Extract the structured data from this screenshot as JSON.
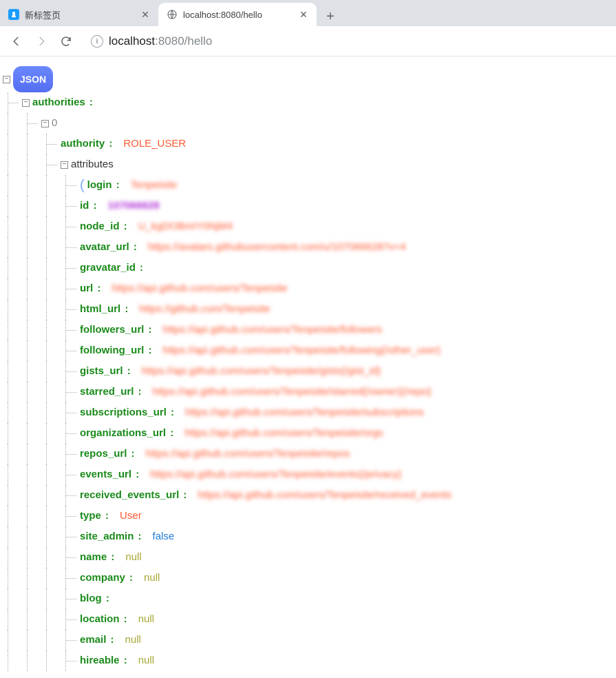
{
  "tabs": {
    "tab1": {
      "title": "新标签页"
    },
    "tab2": {
      "title": "localhost:8080/hello"
    }
  },
  "omnibox": {
    "host": "localhost",
    "rest": ":8080/hello"
  },
  "root_badge": "JSON",
  "tree": {
    "authorities_key": "authorities",
    "index0": "0",
    "authority_key": "authority",
    "authority_val": "ROLE_USER",
    "attributes_key": "attributes",
    "attrs": {
      "login_key": "login",
      "login_val": "Tenpeisite",
      "id_key": "id",
      "id_val": "107066628",
      "node_id_key": "node_id",
      "node_id_val": "U_kgDOBmIY0NjM4",
      "avatar_url_key": "avatar_url",
      "avatar_url_val": "https://avatars.githubusercontent.com/u/107066628?v=4",
      "gravatar_id_key": "gravatar_id",
      "gravatar_id_val": "",
      "url_key": "url",
      "url_val": "https://api.github.com/users/Tenpeisite",
      "html_url_key": "html_url",
      "html_url_val": "https://github.com/Tenpeisite",
      "followers_url_key": "followers_url",
      "followers_url_val": "https://api.github.com/users/Tenpeisite/followers",
      "following_url_key": "following_url",
      "following_url_val": "https://api.github.com/users/Tenpeisite/following{/other_user}",
      "gists_url_key": "gists_url",
      "gists_url_val": "https://api.github.com/users/Tenpeisite/gists{/gist_id}",
      "starred_url_key": "starred_url",
      "starred_url_val": "https://api.github.com/users/Tenpeisite/starred{/owner}{/repo}",
      "subscriptions_url_key": "subscriptions_url",
      "subscriptions_url_val": "https://api.github.com/users/Tenpeisite/subscriptions",
      "organizations_url_key": "organizations_url",
      "organizations_url_val": "https://api.github.com/users/Tenpeisite/orgs",
      "repos_url_key": "repos_url",
      "repos_url_val": "https://api.github.com/users/Tenpeisite/repos",
      "events_url_key": "events_url",
      "events_url_val": "https://api.github.com/users/Tenpeisite/events{/privacy}",
      "received_events_url_key": "received_events_url",
      "received_events_url_val": "https://api.github.com/users/Tenpeisite/received_events",
      "type_key": "type",
      "type_val": "User",
      "site_admin_key": "site_admin",
      "site_admin_val": "false",
      "name_key": "name",
      "name_val": "null",
      "company_key": "company",
      "company_val": "null",
      "blog_key": "blog",
      "blog_val": "",
      "location_key": "location",
      "location_val": "null",
      "email_key": "email",
      "email_val": "null",
      "hireable_key": "hireable",
      "hireable_val": "null"
    }
  }
}
